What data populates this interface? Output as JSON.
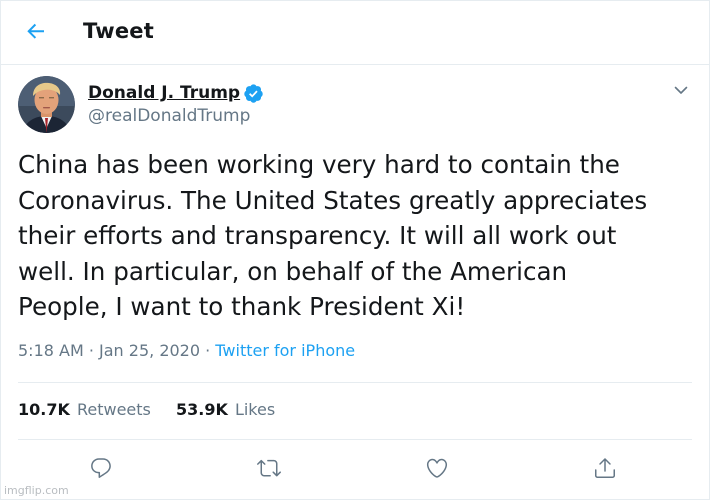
{
  "header": {
    "title": "Tweet"
  },
  "author": {
    "name": "Donald J. Trump",
    "handle": "@realDonaldTrump",
    "verified": true
  },
  "tweet": {
    "text": "China has been working very hard to contain the\nCoronavirus. The United States greatly appreciates\ntheir efforts and transparency. It will all work out\nwell. In particular, on behalf of the American\nPeople, I want to thank President Xi!",
    "time": "5:18 AM",
    "separator": " · ",
    "date": "Jan 25, 2020",
    "source_sep": " · ",
    "source": "Twitter for iPhone"
  },
  "stats": {
    "retweets_count": "10.7K",
    "retweets_label": "Retweets",
    "likes_count": "53.9K",
    "likes_label": "Likes"
  },
  "actions": [
    "reply-icon",
    "retweet-icon",
    "like-icon",
    "share-icon"
  ],
  "watermark": "imgflip.com",
  "colors": {
    "accent": "#1da1f2",
    "text": "#14171a",
    "secondary": "#657786",
    "border": "#e6ecf0"
  }
}
